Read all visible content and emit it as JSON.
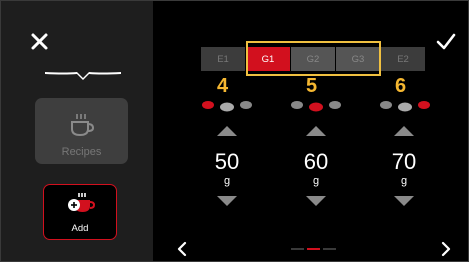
{
  "header": {
    "close_icon": "close-icon",
    "confirm_icon": "checkmark-icon"
  },
  "sidebar": {
    "recipes_label": "Recipes",
    "add_label": "Add",
    "recipes_icon": "coffee-cup-icon",
    "add_icon": "add-cup-icon"
  },
  "grinder_tabs": [
    {
      "label": "E1",
      "state": "inactive"
    },
    {
      "label": "G1",
      "state": "active"
    },
    {
      "label": "G2",
      "state": "in-range"
    },
    {
      "label": "G3",
      "state": "in-range"
    },
    {
      "label": "E2",
      "state": "inactive"
    }
  ],
  "callouts": [
    "4",
    "5",
    "6"
  ],
  "columns": [
    {
      "value": "50",
      "unit": "g",
      "selected_dot": 1
    },
    {
      "value": "60",
      "unit": "g",
      "selected_dot": 2
    },
    {
      "value": "70",
      "unit": "g",
      "selected_dot": 3
    }
  ],
  "pagination": {
    "pages": 3,
    "active_page": 2
  },
  "colors": {
    "accent": "#d2101e",
    "highlight": "#f0c040",
    "callout": "#f5b731",
    "panel": "#1e1e1e"
  }
}
